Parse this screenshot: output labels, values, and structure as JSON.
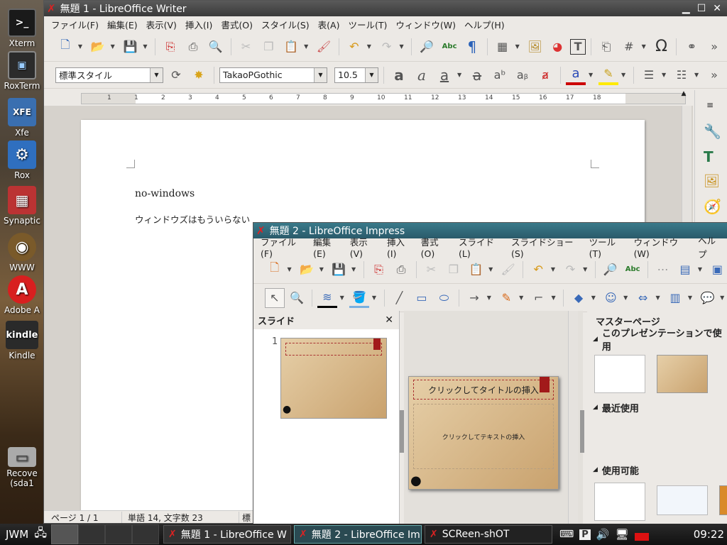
{
  "desktop": {
    "icons": [
      {
        "label": "Xterm",
        "glyph": ">_",
        "bg": "#1a1a1a"
      },
      {
        "label": "RoxTerm",
        "glyph": "▣",
        "bg": "#2b2b2b"
      },
      {
        "label": "Xfe",
        "glyph": "XFE",
        "bg": "#3a6fb0"
      },
      {
        "label": "Rox",
        "glyph": "⚙",
        "bg": "#2f6fbf"
      },
      {
        "label": "Synaptic",
        "glyph": "▦",
        "bg": "#b33"
      },
      {
        "label": "WWW",
        "glyph": "◉",
        "bg": "#7a5a2a"
      },
      {
        "label": "Adobe A",
        "glyph": "A",
        "bg": "#d81f1f"
      },
      {
        "label": "Kindle",
        "glyph": "kindle",
        "bg": "#2a2a2a"
      },
      {
        "label": "Recove",
        "glyph": "▭",
        "bg": "#888"
      }
    ],
    "recover_sub": "(sda1"
  },
  "writer": {
    "title": "無題 1 - LibreOffice Writer",
    "menu": [
      "ファイル(F)",
      "編集(E)",
      "表示(V)",
      "挿入(I)",
      "書式(O)",
      "スタイル(S)",
      "表(A)",
      "ツール(T)",
      "ウィンドウ(W)",
      "ヘルプ(H)"
    ],
    "paragraph_style": "標準スタイル",
    "font_name": "TakaoPGothic",
    "font_size": "10.5",
    "ruler_ticks": [
      "1",
      "1",
      "2",
      "3",
      "4",
      "5",
      "6",
      "7",
      "8",
      "9",
      "10",
      "11",
      "12",
      "13",
      "14",
      "15",
      "16",
      "17",
      "18"
    ],
    "doc_line1": "no-windows",
    "doc_line2": "ウィンドウズはもういらない",
    "status_page": "ページ 1 / 1",
    "status_words": "単語 14, 文字数 23",
    "status_style": "標"
  },
  "impress": {
    "title": "無題 2 - LibreOffice Impress",
    "menu": [
      "ファイル(F)",
      "編集(E)",
      "表示(V)",
      "挿入(I)",
      "書式(O)",
      "スライド(L)",
      "スライドショー(S)",
      "ツール(T)",
      "ウィンドウ(W)",
      "ヘルプ"
    ],
    "slides_panel_title": "スライド",
    "slide_number": "1",
    "slide_title_placeholder": "クリックしてタイトルの挿入",
    "slide_text_placeholder": "クリックしてテキストの挿入",
    "master_pages_title": "マスターページ",
    "section_in_use": "このプレゼンテーションで使用",
    "section_recent": "最近使用",
    "section_available": "使用可能"
  },
  "taskbar": {
    "start": "JWM",
    "tasks": [
      "無題 1 - LibreOffice W",
      "無題 2 - LibreOffice Im",
      "SCReen-shOT"
    ],
    "clock": "09:22"
  }
}
